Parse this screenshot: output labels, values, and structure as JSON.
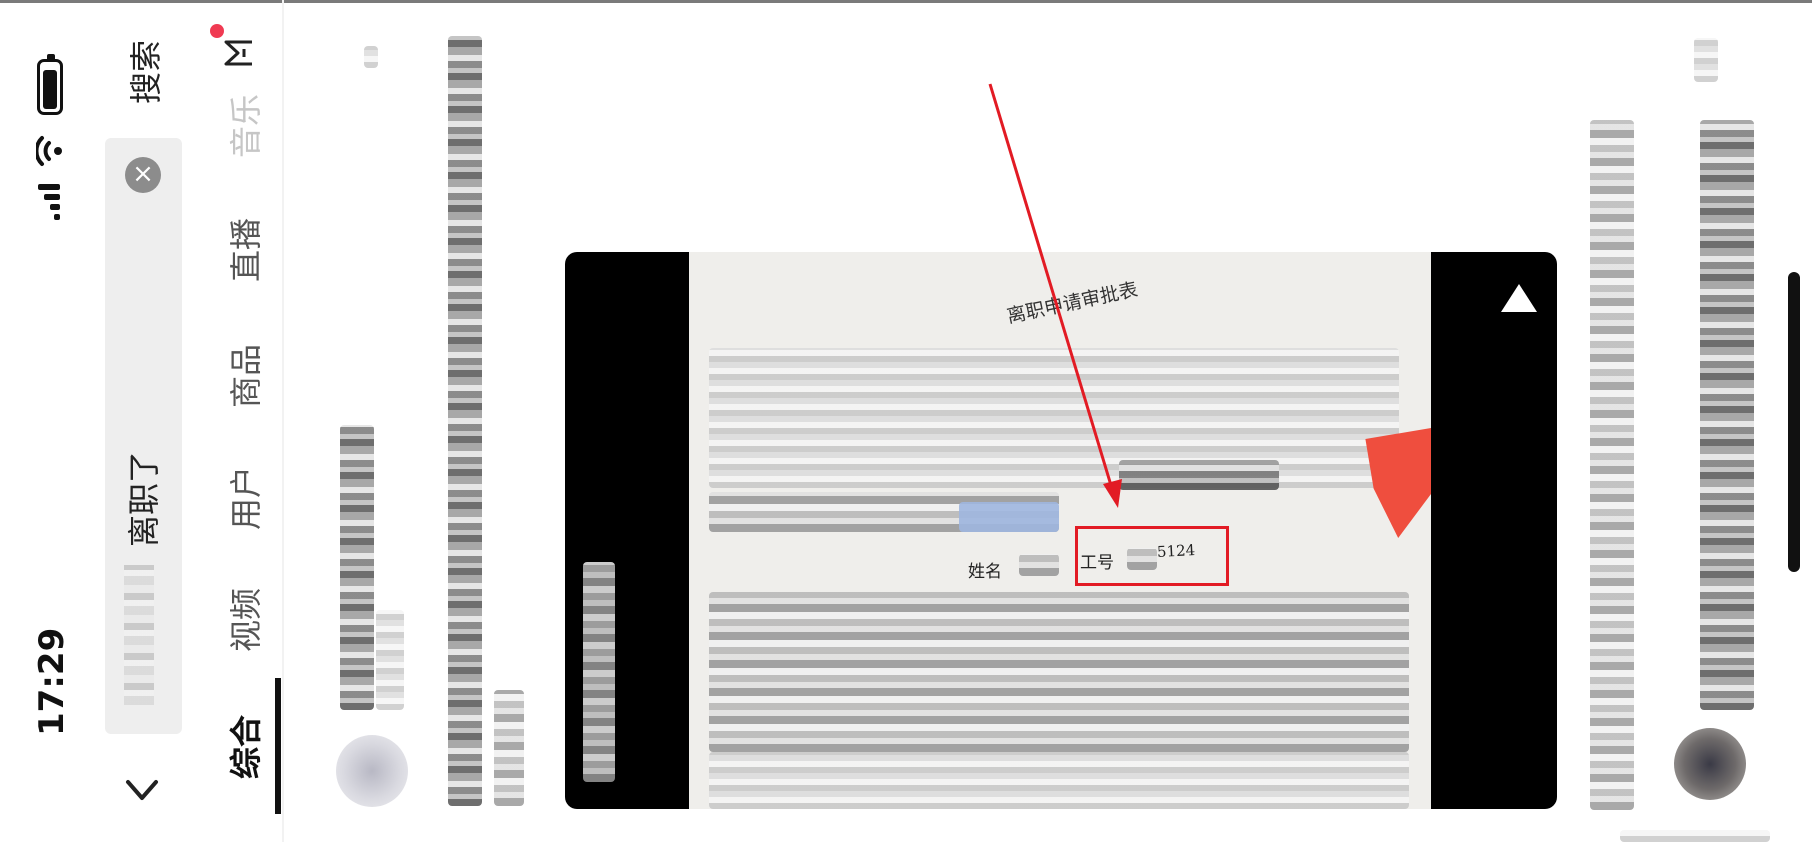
{
  "status_bar": {
    "time": "17:29"
  },
  "search": {
    "query": "离职了",
    "submit_label": "搜索"
  },
  "tabs": [
    {
      "label": "综合",
      "active": true
    },
    {
      "label": "视频"
    },
    {
      "label": "用户"
    },
    {
      "label": "商品"
    },
    {
      "label": "直播"
    },
    {
      "label": "音乐"
    }
  ],
  "video_card": {
    "form_title": "离职申请审批表",
    "name_label": "姓名",
    "employee_no_label": "工号",
    "employee_no_value": "5124"
  },
  "colors": {
    "highlight": "#e21b24",
    "notification_dot": "#f03a52"
  }
}
